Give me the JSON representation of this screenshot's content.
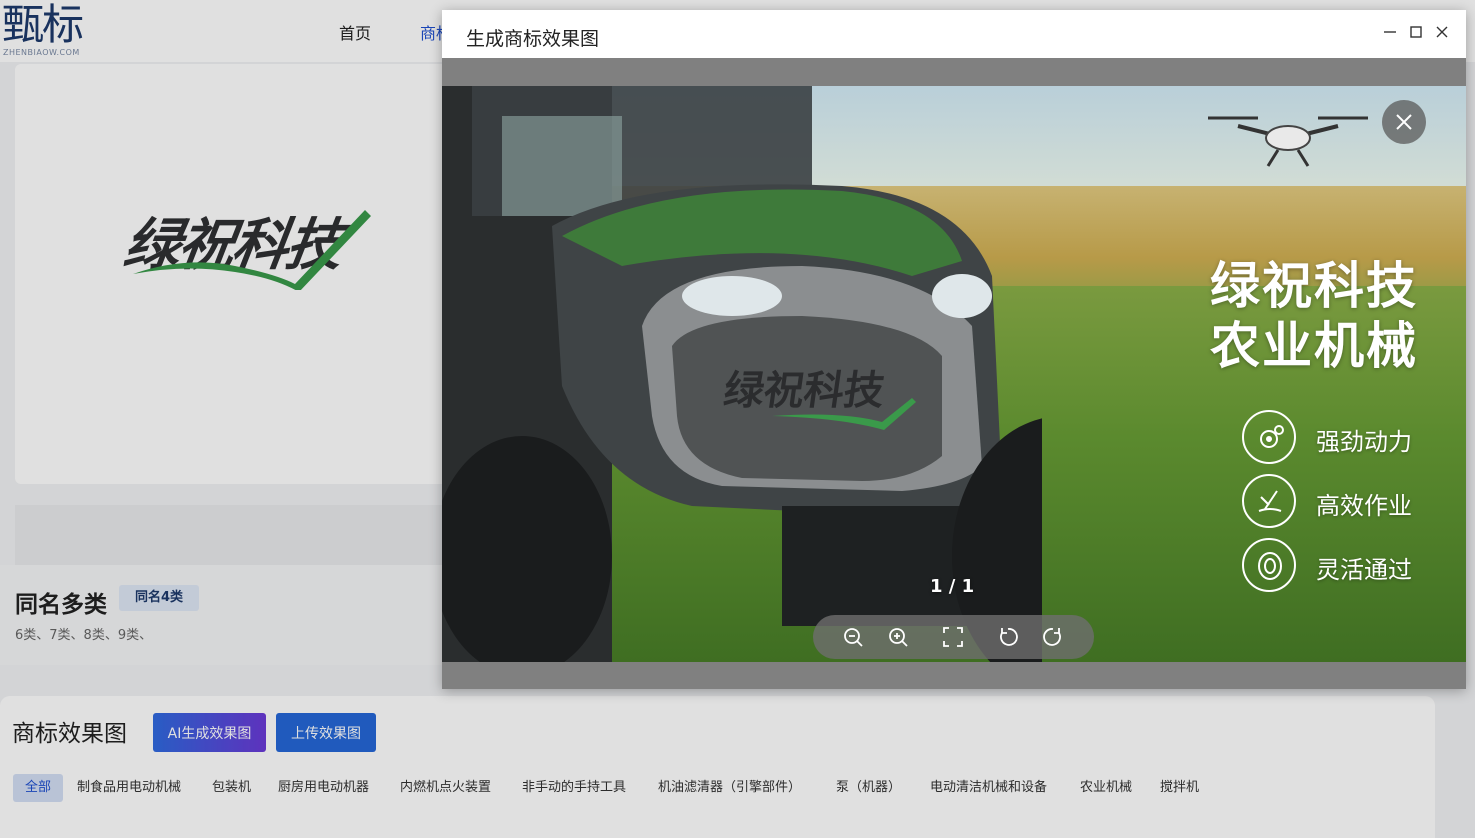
{
  "header": {
    "logo_text": "甄标",
    "logo_sub": "ZHENBIAOW.COM",
    "nav": [
      "首页",
      "商标"
    ]
  },
  "brand": {
    "name": "绿祝科技"
  },
  "same_name": {
    "title": "同名多类",
    "badge": "同名4类",
    "classes": "6类、7类、8类、9类、"
  },
  "effects": {
    "title": "商标效果图",
    "ai_button": "AI生成效果图",
    "upload_button": "上传效果图",
    "categories": [
      "全部",
      "制食品用电动机械",
      "包装机",
      "厨房用电动机器",
      "内燃机点火装置",
      "非手动的手持工具",
      "机油滤清器（引擎部件）",
      "泵（机器）",
      "电动清洁机械和设备",
      "农业机械",
      "搅拌机"
    ]
  },
  "modal": {
    "title": "生成商标效果图",
    "counter": "1 / 1",
    "ad_line1": "绿祝科技",
    "ad_line2": "农业机械",
    "features": [
      "强劲动力",
      "高效作业",
      "灵活通过"
    ],
    "icons": {
      "minimize": "minimize-icon",
      "maximize": "maximize-icon",
      "close": "close-icon",
      "zoom_out": "zoom-out-icon",
      "zoom_in": "zoom-in-icon",
      "fullscreen": "fullscreen-icon",
      "rotate_left": "rotate-left-icon",
      "rotate_right": "rotate-right-icon"
    }
  },
  "colors": {
    "accent_blue": "#2567d8",
    "brand_green": "#3a9a4a",
    "logo_navy": "#1d3a6b"
  }
}
